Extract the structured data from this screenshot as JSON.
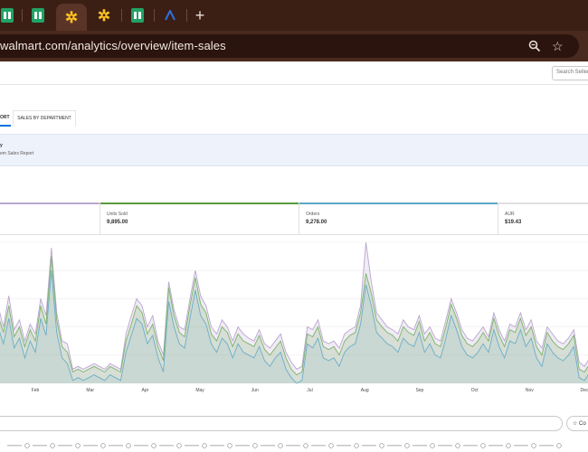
{
  "browser": {
    "tabs": [
      {
        "icon": "google-sheets-icon",
        "active": false
      },
      {
        "icon": "google-sheets-icon",
        "active": false
      },
      {
        "icon": "walmart-spark-icon",
        "active": true
      },
      {
        "icon": "walmart-spark-icon",
        "active": false
      },
      {
        "icon": "google-sheets-icon",
        "active": false
      },
      {
        "icon": "app-a-icon",
        "active": false
      }
    ],
    "new_tab_glyph": "+",
    "url": "walmart.com/analytics/overview/item-sales"
  },
  "header": {
    "search_seller_placeholder": "Search Seller"
  },
  "tabs": {
    "report_tab_label": "ORT",
    "sales_by_department_label": "SALES BY DEPARTMENT"
  },
  "report": {
    "title": "y",
    "subtitle": "em Sales Report"
  },
  "metrics": [
    {
      "label": "Units Sold",
      "value": "9,895.00",
      "accent": "#5a9a3c"
    },
    {
      "label": "Orders",
      "value": "9,278.00",
      "accent": "#5aa9c9"
    },
    {
      "label": "AUR",
      "value": "$19.43",
      "accent": "#e0e0e0"
    }
  ],
  "chart_data": {
    "type": "area",
    "x_labels": [
      "Feb",
      "Mar",
      "Apr",
      "May",
      "Jun",
      "Jul",
      "Aug",
      "Sep",
      "Oct",
      "Nov",
      "Dec"
    ],
    "series": [
      {
        "color": "#b9a6cf",
        "values": [
          30,
          55,
          40,
          62,
          38,
          45,
          30,
          42,
          35,
          60,
          48,
          96,
          50,
          30,
          28,
          10,
          12,
          10,
          12,
          14,
          12,
          10,
          14,
          12,
          10,
          35,
          48,
          60,
          55,
          40,
          48,
          30,
          20,
          72,
          52,
          40,
          38,
          60,
          80,
          62,
          55,
          40,
          35,
          45,
          40,
          30,
          40,
          35,
          32,
          30,
          38,
          28,
          25,
          30,
          35,
          22,
          15,
          10,
          12,
          40,
          38,
          45,
          30,
          28,
          30,
          25,
          35,
          38,
          40,
          55,
          100,
          72,
          50,
          45,
          40,
          38,
          35,
          45,
          40,
          38,
          48,
          35,
          40,
          32,
          30,
          45,
          60,
          50,
          38,
          32,
          30,
          35,
          40,
          33,
          50,
          38,
          30,
          42,
          40,
          50,
          38,
          45,
          30,
          25,
          40,
          35,
          30,
          28,
          32,
          38,
          15,
          12,
          18
        ]
      },
      {
        "color": "#7bb36b",
        "values": [
          25,
          48,
          36,
          55,
          33,
          40,
          26,
          38,
          30,
          55,
          42,
          90,
          45,
          26,
          22,
          8,
          10,
          8,
          10,
          12,
          10,
          8,
          12,
          10,
          8,
          30,
          42,
          55,
          50,
          35,
          42,
          26,
          16,
          68,
          48,
          36,
          33,
          55,
          75,
          56,
          50,
          35,
          30,
          40,
          36,
          26,
          35,
          30,
          28,
          26,
          34,
          24,
          20,
          25,
          30,
          18,
          10,
          6,
          8,
          35,
          33,
          40,
          26,
          24,
          26,
          20,
          30,
          34,
          36,
          50,
          78,
          64,
          45,
          40,
          36,
          34,
          30,
          40,
          36,
          34,
          44,
          30,
          36,
          28,
          26,
          40,
          56,
          46,
          34,
          28,
          26,
          30,
          36,
          30,
          46,
          34,
          26,
          38,
          36,
          46,
          34,
          40,
          26,
          20,
          36,
          30,
          26,
          24,
          28,
          34,
          10,
          8,
          14
        ]
      },
      {
        "color": "#6aaec8",
        "values": [
          18,
          40,
          28,
          46,
          25,
          32,
          18,
          30,
          22,
          46,
          34,
          80,
          36,
          18,
          14,
          2,
          4,
          2,
          4,
          6,
          4,
          2,
          6,
          4,
          2,
          22,
          34,
          46,
          42,
          28,
          34,
          18,
          8,
          58,
          40,
          28,
          25,
          46,
          66,
          48,
          42,
          28,
          22,
          32,
          28,
          18,
          28,
          22,
          20,
          18,
          26,
          16,
          12,
          18,
          22,
          10,
          4,
          0,
          2,
          28,
          25,
          32,
          18,
          16,
          18,
          12,
          22,
          26,
          28,
          42,
          70,
          55,
          36,
          32,
          28,
          26,
          22,
          32,
          28,
          26,
          36,
          22,
          28,
          20,
          18,
          32,
          48,
          38,
          26,
          20,
          18,
          22,
          28,
          22,
          38,
          26,
          18,
          30,
          28,
          38,
          26,
          32,
          18,
          12,
          28,
          22,
          18,
          16,
          20,
          26,
          4,
          2,
          8
        ]
      }
    ],
    "ylim": [
      0,
      100
    ],
    "grid": true
  },
  "bottom": {
    "customize_label": "Co"
  }
}
